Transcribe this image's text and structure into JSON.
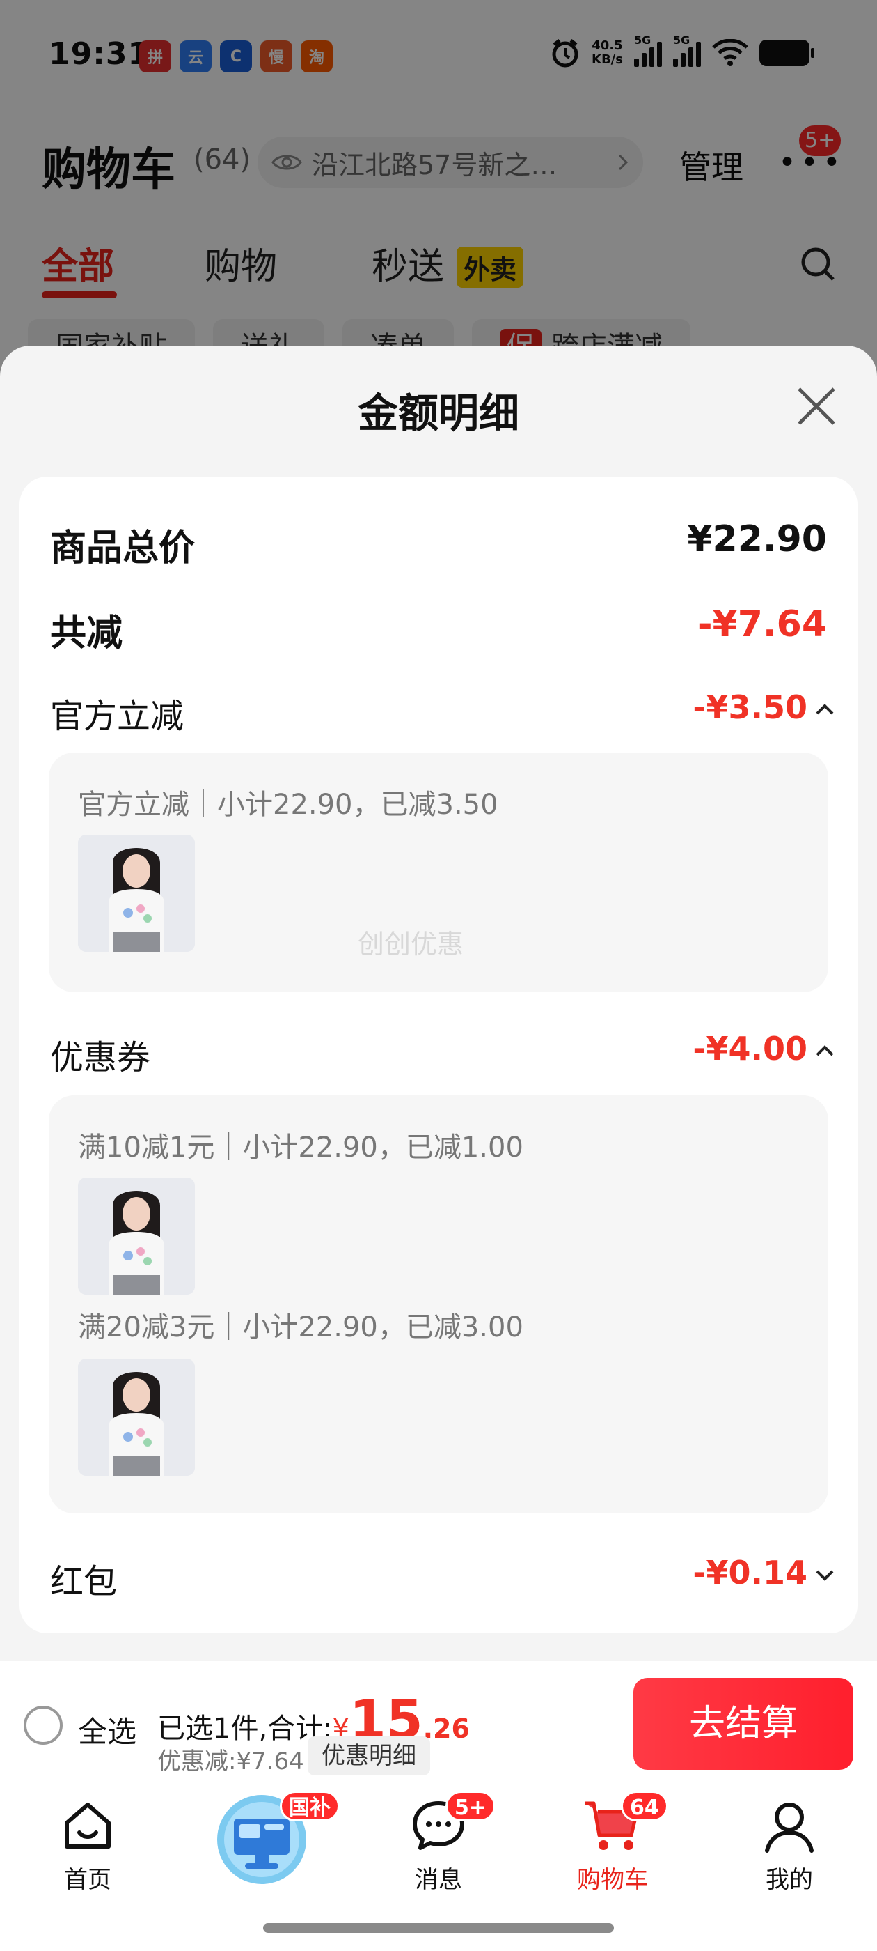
{
  "status_bar": {
    "time": "19:31",
    "net_speed_value": "40.5",
    "net_speed_unit": "KB/s",
    "signal_1_label": "5G",
    "signal_2_label": "5G",
    "app_icons": [
      "拼",
      "云",
      "C",
      "慢",
      "淘"
    ]
  },
  "header": {
    "title": "购物车",
    "count": "(64)",
    "address": "沿江北路57号新之…",
    "manage": "管理",
    "more_badge": "5+"
  },
  "tabs": [
    {
      "label": "全部",
      "active": true
    },
    {
      "label": "购物",
      "active": false
    },
    {
      "label": "秒送",
      "active": false
    }
  ],
  "tab_tag": "外卖",
  "chips": [
    {
      "label": "国家补贴"
    },
    {
      "label": "送礼"
    },
    {
      "label": "凑单"
    },
    {
      "tag": "促",
      "label": "跨店满减"
    }
  ],
  "sheet": {
    "title": "金额明细",
    "total_label": "商品总价",
    "total_value": "¥22.90",
    "reduce_label": "共减",
    "reduce_value": "-¥7.64",
    "official": {
      "label": "官方立减",
      "value": "-¥3.50",
      "line": "官方立减｜小计22.90，已减3.50"
    },
    "coupon": {
      "label": "优惠券",
      "value": "-¥4.00",
      "line1": "满10减1元｜小计22.90，已减1.00",
      "line2": "满20减3元｜小计22.90，已减3.00"
    },
    "redpacket": {
      "label": "红包",
      "value": "-¥0.14"
    },
    "watermark": "创创优惠"
  },
  "checkout": {
    "select_all": "全选",
    "selected_prefix": "已选1件,合计:",
    "currency": "¥",
    "price_int": "15",
    "price_dec": ".26",
    "discount": "优惠减:¥7.64",
    "detail_btn": "优惠明细",
    "pay_btn": "去结算"
  },
  "nav": {
    "home": "首页",
    "guobu_badge": "国补",
    "messages": "消息",
    "messages_badge": "5+",
    "cart": "购物车",
    "cart_badge": "64",
    "mine": "我的"
  },
  "colors": {
    "accent_red": "#e8231b",
    "price_red": "#f03226",
    "tag_yellow": "#ffd400"
  }
}
